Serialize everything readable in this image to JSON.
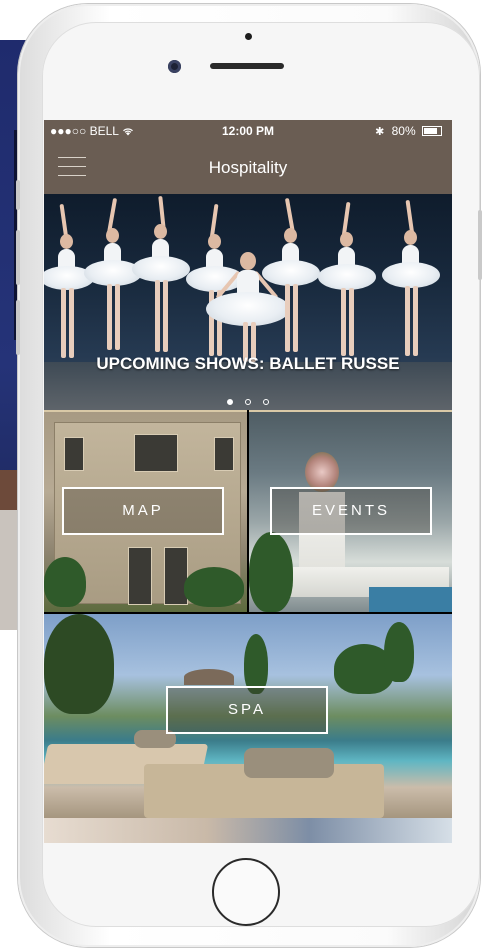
{
  "status_bar": {
    "carrier": "●●●○○ BELL",
    "wifi_icon": "wifi-icon",
    "time": "12:00 PM",
    "bluetooth_icon": "bluetooth-icon",
    "battery_pct": "80%"
  },
  "nav": {
    "title": "Hospitality",
    "menu_icon": "hamburger-menu-icon"
  },
  "hero": {
    "caption": "UPCOMING SHOWS: BALLET RUSSE",
    "active_page": 1,
    "page_count": 3
  },
  "tiles": {
    "map": "MAP",
    "events": "EVENTS",
    "spa": "SPA"
  },
  "colors": {
    "nav_background": "#6a5d53",
    "accent_border": "#d9c9a7"
  }
}
